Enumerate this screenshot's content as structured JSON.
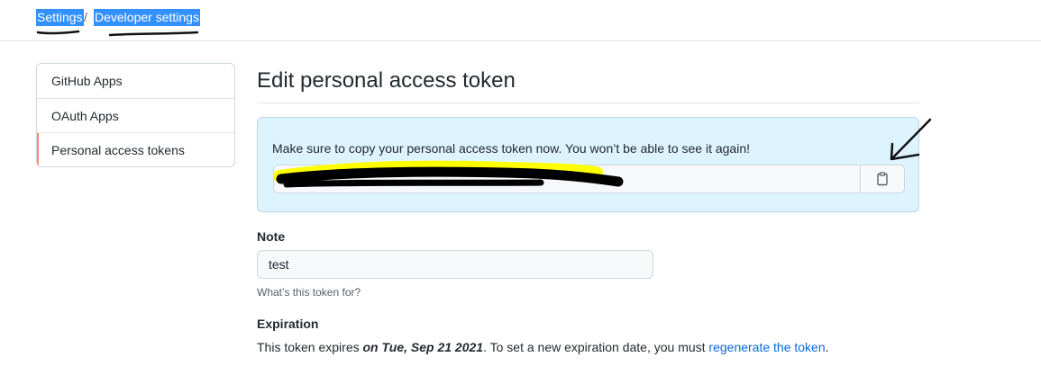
{
  "breadcrumb": {
    "settings": "Settings",
    "separator": "/",
    "developer_settings": "Developer settings"
  },
  "sidebar": {
    "items": [
      {
        "label": "GitHub Apps"
      },
      {
        "label": "OAuth Apps"
      },
      {
        "label": "Personal access tokens",
        "selected": true
      }
    ]
  },
  "main": {
    "title": "Edit personal access token",
    "flash": {
      "message": "Make sure to copy your personal access token now. You won’t be able to see it again!",
      "copy_icon": "clipboard-icon"
    },
    "note": {
      "label": "Note",
      "value": "test",
      "hint": "What’s this token for?"
    },
    "expiration": {
      "label": "Expiration",
      "prefix": "This token expires ",
      "date": "on Tue, Sep 21 2021",
      "middle": ". To set a new expiration date, you must ",
      "link": "regenerate the token",
      "suffix": "."
    }
  },
  "colors": {
    "link": "#0969da",
    "selected_accent": "#fd8c73",
    "flash_bg": "#ddf4ff",
    "text_highlight": "#3390ff",
    "redaction_highlight": "#ffff00"
  }
}
